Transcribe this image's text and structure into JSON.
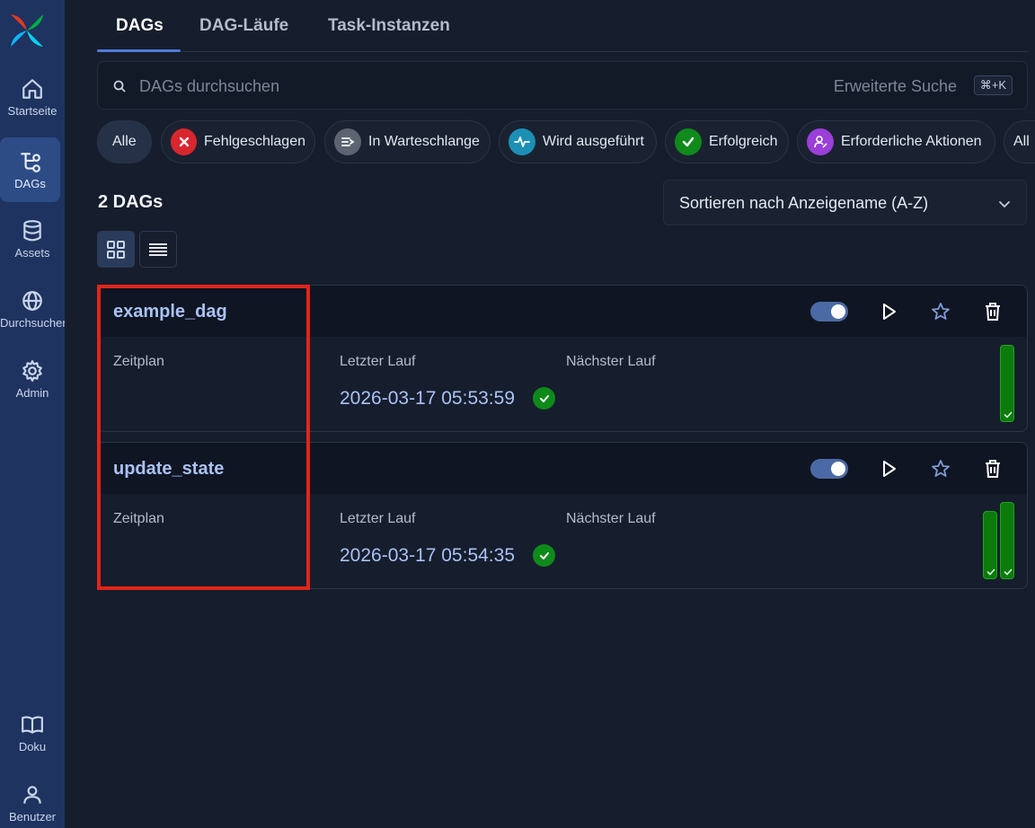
{
  "sidebar": {
    "items": [
      {
        "label": "Startseite",
        "icon": "home-icon"
      },
      {
        "label": "DAGs",
        "icon": "dag-icon",
        "active": true
      },
      {
        "label": "Assets",
        "icon": "database-icon"
      },
      {
        "label": "Durchsuchen",
        "icon": "globe-icon"
      },
      {
        "label": "Admin",
        "icon": "gear-icon"
      }
    ],
    "bottom": [
      {
        "label": "Doku",
        "icon": "book-icon"
      },
      {
        "label": "Benutzer",
        "icon": "user-icon"
      }
    ]
  },
  "tabs": [
    {
      "label": "DAGs",
      "active": true
    },
    {
      "label": "DAG-Läufe"
    },
    {
      "label": "Task-Instanzen"
    }
  ],
  "search": {
    "placeholder": "DAGs durchsuchen",
    "advanced": "Erweiterte Suche",
    "shortcut": "⌘+K"
  },
  "filters": [
    {
      "label": "Alle"
    },
    {
      "label": "Fehlgeschlagen",
      "color": "#d9262e"
    },
    {
      "label": "In Warteschlange",
      "color": "#5d6370"
    },
    {
      "label": "Wird ausgeführt",
      "color": "#1c8fb5"
    },
    {
      "label": "Erfolgreich",
      "color": "#0f8a1b"
    },
    {
      "label": "Erforderliche Aktionen",
      "color": "#9b3fd8"
    },
    {
      "label": "All"
    }
  ],
  "dag_count": "2 DAGs",
  "sort": {
    "label": "Sortieren nach Anzeigename (A-Z)"
  },
  "dags": [
    {
      "id": "example_dag",
      "schedule_label": "Zeitplan",
      "last_run_label": "Letzter Lauf",
      "next_run_label": "Nächster Lauf",
      "last_run": "2026-03-17 05:53:59",
      "last_run_state": "success",
      "recent_runs": [
        {
          "state": "success",
          "duration_fraction": 1.0
        }
      ]
    },
    {
      "id": "update_state",
      "schedule_label": "Zeitplan",
      "last_run_label": "Letzter Lauf",
      "next_run_label": "Nächster Lauf",
      "last_run": "2026-03-17 05:54:35",
      "last_run_state": "success",
      "recent_runs": [
        {
          "state": "success",
          "duration_fraction": 0.88
        },
        {
          "state": "success",
          "duration_fraction": 1.0
        }
      ]
    }
  ],
  "colors": {
    "accent": "#4f7bd8",
    "success": "#0e8a1a",
    "highlight": "#e0251b"
  }
}
